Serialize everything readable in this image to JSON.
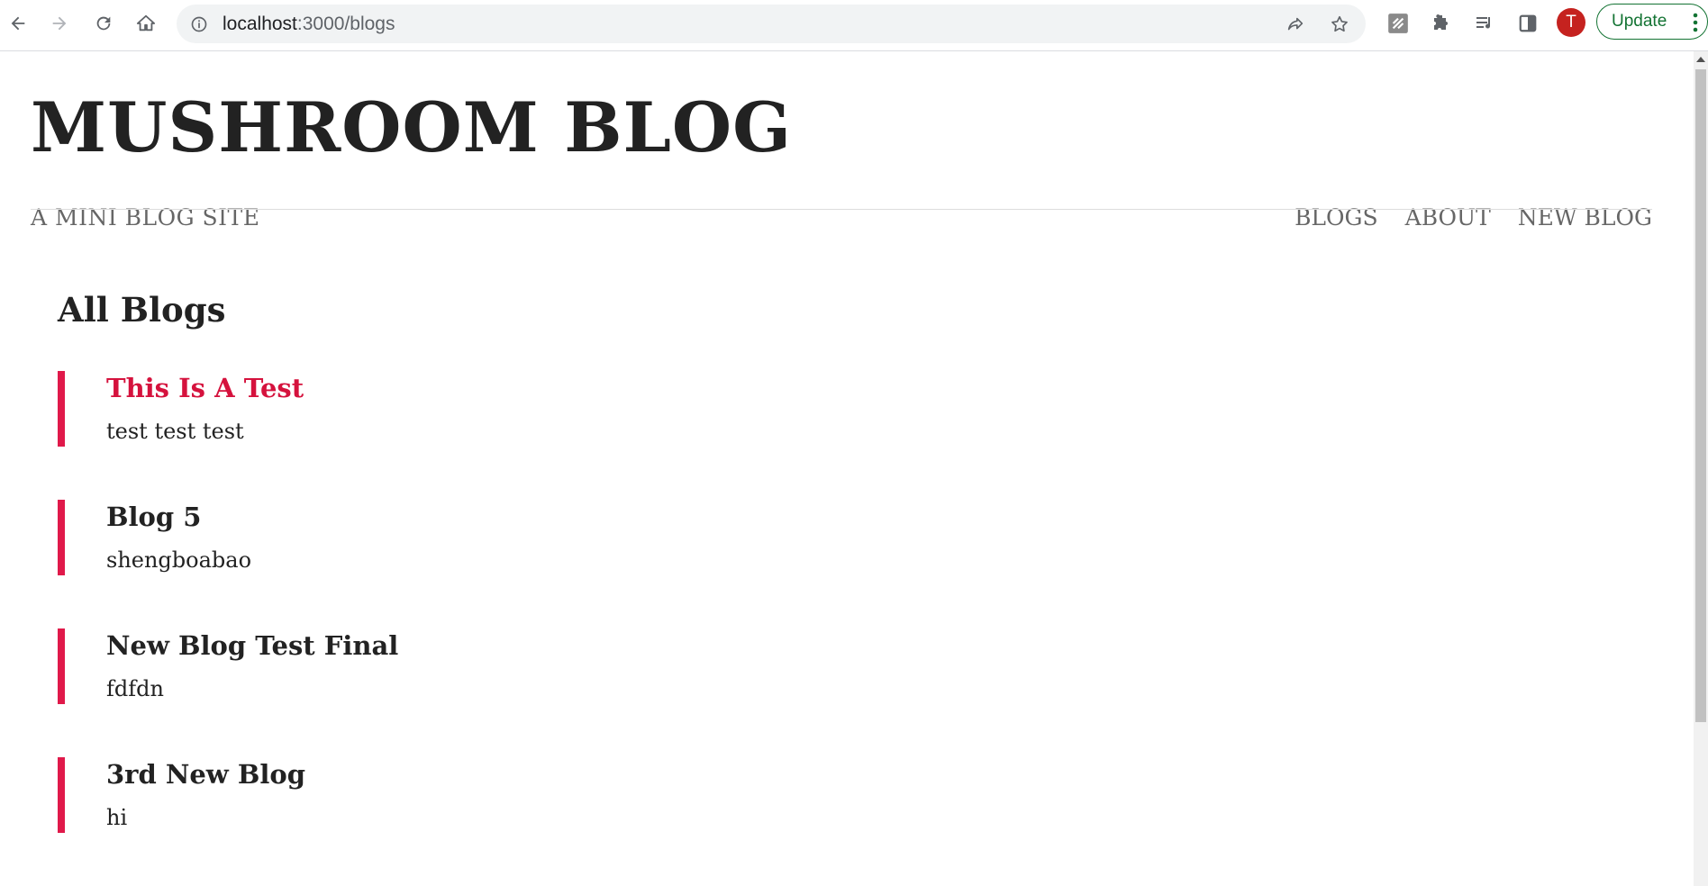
{
  "browser": {
    "url_host": "localhost",
    "url_path": ":3000/blogs",
    "avatar_letter": "T",
    "update_label": "Update"
  },
  "site": {
    "title": "MUSHROOM BLOG",
    "subtitle": "A MINI BLOG SITE",
    "nav": [
      "BLOGS",
      "ABOUT",
      "NEW BLOG"
    ]
  },
  "main": {
    "heading": "All Blogs",
    "blogs": [
      {
        "title": "This Is A Test",
        "snippet": "test test test",
        "highlighted": true
      },
      {
        "title": "Blog 5",
        "snippet": "shengboabao",
        "highlighted": false
      },
      {
        "title": "New Blog Test Final",
        "snippet": "fdfdn",
        "highlighted": false
      },
      {
        "title": "3rd New Blog",
        "snippet": "hi",
        "highlighted": false
      }
    ]
  },
  "colors": {
    "accent": "#e0194a",
    "accent_text": "#d5123d",
    "update_green": "#137333"
  }
}
